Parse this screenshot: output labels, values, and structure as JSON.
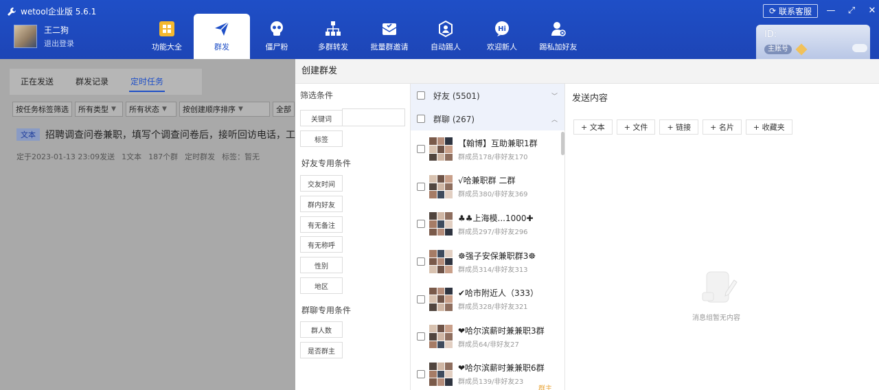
{
  "app": {
    "title": "wetool企业版 5.6.1"
  },
  "user": {
    "name": "王二狗",
    "logout": "退出登录"
  },
  "nav": [
    {
      "label": "功能大全",
      "icon": "grid-icon"
    },
    {
      "label": "群发",
      "icon": "send-icon"
    },
    {
      "label": "僵尸粉",
      "icon": "skull-icon"
    },
    {
      "label": "多群转发",
      "icon": "org-chart-icon"
    },
    {
      "label": "批量群邀请",
      "icon": "invite-envelope-icon"
    },
    {
      "label": "自动踢人",
      "icon": "kick-icon"
    },
    {
      "label": "欢迎新人",
      "icon": "hi-bubble-icon"
    },
    {
      "label": "踢私加好友",
      "icon": "user-x-icon"
    }
  ],
  "header": {
    "service": "联系客服",
    "id_label": "ID:",
    "badge": "主账号"
  },
  "left": {
    "tabs": [
      "正在发送",
      "群发记录",
      "定时任务"
    ],
    "filters": [
      "按任务标签筛选",
      "所有类型",
      "所有状态",
      "按创建顺序排序",
      "全部"
    ],
    "task": {
      "tag": "文本",
      "text": "招聘调查问卷兼职，填写个调查问卷后，接听回访电话，工",
      "meta": [
        "定于2023-01-13 23:09发送",
        "1文本",
        "187个群",
        "定时群发",
        "标签：暂无"
      ]
    }
  },
  "dialog": {
    "title": "创建群发",
    "filter_title": "筛选条件",
    "keyword_label": "关键词",
    "tag_label": "标签",
    "friend_cond_title": "好友专用条件",
    "friend_conds": [
      "交友时间",
      "群内好友",
      "有无备注",
      "有无称呼",
      "性别",
      "地区"
    ],
    "group_cond_title": "群聊专用条件",
    "group_conds": [
      "群人数",
      "是否群主"
    ],
    "friends_group": "好友 (5501)",
    "chats_group": "群聊 (267)",
    "groups": [
      {
        "name": "【翰博】互助兼职1群",
        "sub": "群成员178/非好友170"
      },
      {
        "name": "√哈兼职群 二群",
        "sub": "群成员380/非好友369"
      },
      {
        "name": "♣♣上海模...1000✚",
        "sub": "群成员297/非好友296"
      },
      {
        "name": "☸强子安保兼职群3☸",
        "sub": "群成员314/非好友313"
      },
      {
        "name": "✔哈市附近人（333）",
        "sub": "群成员328/非好友321"
      },
      {
        "name": "❤哈尔滨薪时兼兼职3群",
        "sub": "群成员64/非好友27"
      },
      {
        "name": "❤哈尔滨薪时兼兼职6群",
        "sub": "群成员139/非好友23",
        "owner": "群主"
      }
    ],
    "content_title": "发送内容",
    "content_buttons": [
      "+ 文本",
      "+ 文件",
      "+ 链接",
      "+ 名片",
      "+ 收藏夹"
    ],
    "empty_text": "消息组暂无内容"
  },
  "colors": {
    "brand": "#1f4fc7",
    "owner": "#e8a63c"
  }
}
